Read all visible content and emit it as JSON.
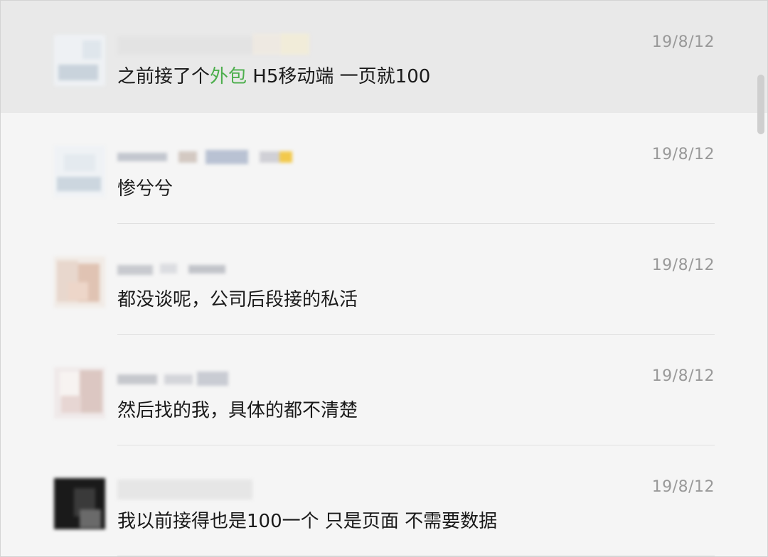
{
  "messages": [
    {
      "time": "19/8/12",
      "text_before": "之前接了个",
      "text_highlight": "外包",
      "text_after": " H5移动端 一页就100"
    },
    {
      "time": "19/8/12",
      "text": "惨兮兮"
    },
    {
      "time": "19/8/12",
      "text": "都没谈呢，公司后段接的私活"
    },
    {
      "time": "19/8/12",
      "text": "然后找的我，具体的都不清楚"
    },
    {
      "time": "19/8/12",
      "text": "我以前接得也是100一个 只是页面 不需要数据"
    }
  ],
  "colors": {
    "highlight": "#4cae4c",
    "selected_row_bg": "#e9e9e9",
    "list_bg": "#f5f5f5",
    "timestamp": "#999999"
  }
}
